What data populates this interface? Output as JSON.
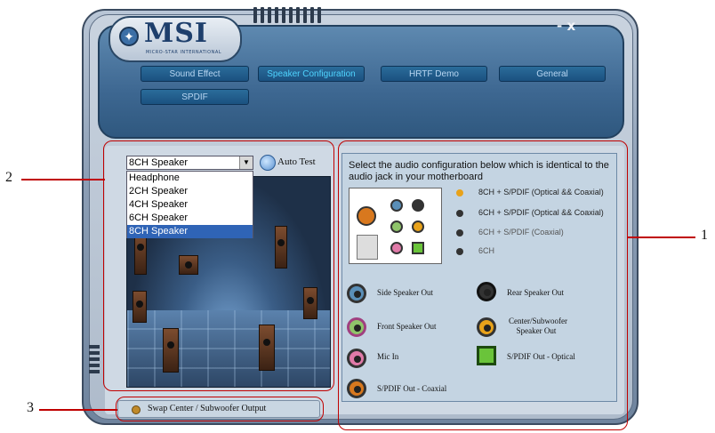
{
  "app": {
    "logo_text": "MSI",
    "logo_subtext": "MICRO-STAR INTERNATIONAL",
    "window_controls": "- x"
  },
  "tabs": [
    {
      "label": "Sound Effect",
      "active": false
    },
    {
      "label": "Speaker Configuration",
      "active": true
    },
    {
      "label": "HRTF Demo",
      "active": false
    },
    {
      "label": "General",
      "active": false
    },
    {
      "label": "SPDIF",
      "active": false
    }
  ],
  "speaker_select": {
    "value": "8CH Speaker",
    "options": [
      "Headphone",
      "2CH Speaker",
      "4CH Speaker",
      "6CH Speaker",
      "8CH Speaker"
    ],
    "selected_option": "8CH Speaker"
  },
  "auto_test": {
    "label": "Auto Test"
  },
  "instructions": "Select the audio configuration below which is identical to the audio jack in your motherboard",
  "configs": [
    {
      "label": "8CH + S/PDIF (Optical && Coaxial)",
      "color": "#e8a21a",
      "selected": true
    },
    {
      "label": "6CH + S/PDIF (Optical && Coaxial)",
      "color": "#333333",
      "selected": false
    },
    {
      "label": "6CH + S/PDIF (Coaxial)",
      "color": "#333333",
      "selected": false
    },
    {
      "label": "6CH",
      "color": "#333333",
      "selected": false
    }
  ],
  "legend": [
    {
      "label": "Side Speaker Out",
      "icon": "side-speaker-jack-icon",
      "color": "#5a8fb8"
    },
    {
      "label": "Rear Speaker Out",
      "icon": "rear-speaker-jack-icon",
      "color": "#333333"
    },
    {
      "label": "Front Speaker Out",
      "icon": "front-speaker-jack-icon",
      "color": "#8fc46a"
    },
    {
      "label": "Center/Subwoofer Speaker Out",
      "icon": "center-subwoofer-jack-icon",
      "color": "#e8a21a"
    },
    {
      "label": "Mic In",
      "icon": "mic-jack-icon",
      "color": "#e07aa8"
    },
    {
      "label": "S/PDIF Out - Optical",
      "icon": "spdif-optical-icon",
      "color": "#6ac43a"
    },
    {
      "label": "S/PDIF Out - Coaxial",
      "icon": "spdif-coaxial-icon",
      "color": "#d8781e"
    }
  ],
  "swap_option": {
    "label": "Swap Center / Subwoofer Output"
  },
  "callouts": [
    "1",
    "2",
    "3"
  ]
}
